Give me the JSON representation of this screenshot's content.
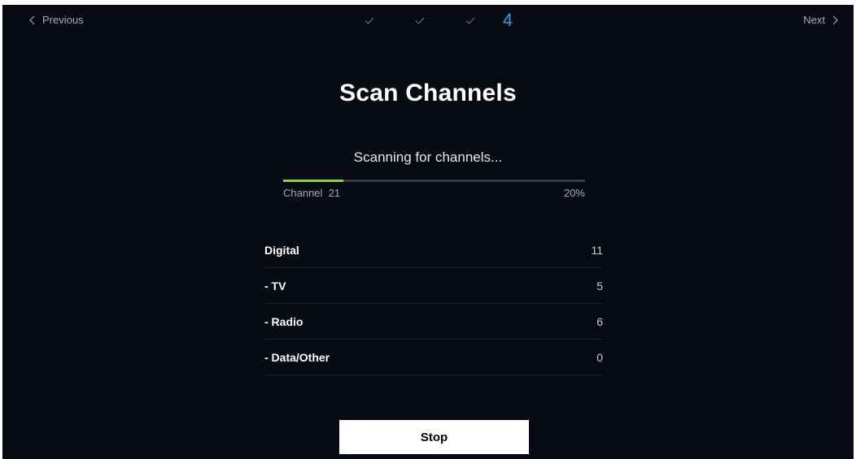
{
  "nav": {
    "previous_label": "Previous",
    "next_label": "Next"
  },
  "steps": {
    "completed_count": 3,
    "current": "4"
  },
  "page": {
    "title": "Scan Channels",
    "status": "Scanning for channels..."
  },
  "progress": {
    "channel_label": "Channel  21",
    "percent_label": "20%",
    "fraction": 0.2
  },
  "counts": [
    {
      "label": "Digital",
      "value": "11"
    },
    {
      "label": "- TV",
      "value": "5"
    },
    {
      "label": "- Radio",
      "value": "6"
    },
    {
      "label": "- Data/Other",
      "value": "0"
    }
  ],
  "actions": {
    "stop_label": "Stop"
  },
  "colors": {
    "background": "#080a12",
    "accent_step": "#2f9ee8",
    "progress_fill": "#8ed23c",
    "progress_track": "#3a3d45"
  },
  "icons": {
    "previous": "chevron-left-icon",
    "next": "chevron-right-icon",
    "step_done": "checkmark-icon"
  }
}
